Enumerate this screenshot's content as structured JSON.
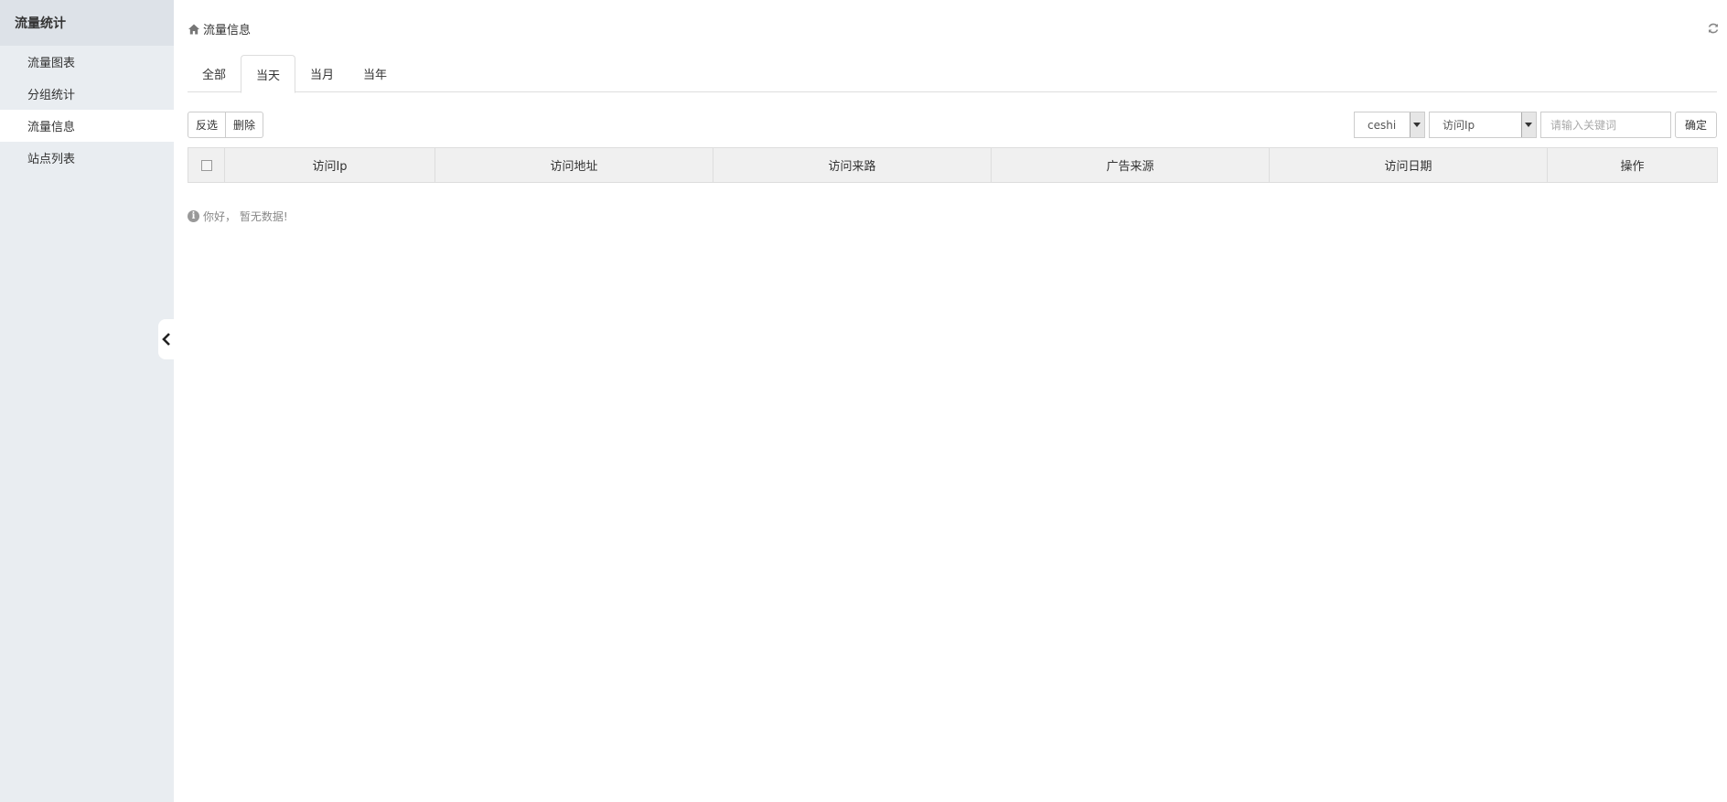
{
  "sidebar": {
    "title": "流量统计",
    "items": [
      {
        "label": "流量图表"
      },
      {
        "label": "分组统计"
      },
      {
        "label": "流量信息"
      },
      {
        "label": "站点列表"
      }
    ],
    "active_index": 2
  },
  "header": {
    "title": "流量信息"
  },
  "tabs": [
    {
      "label": "全部"
    },
    {
      "label": "当天"
    },
    {
      "label": "当月"
    },
    {
      "label": "当年"
    }
  ],
  "active_tab": 1,
  "toolbar": {
    "invert_label": "反选",
    "delete_label": "删除"
  },
  "filters": {
    "site_select": "ceshi",
    "field_select": "访问Ip",
    "keyword_placeholder": "请输入关键词",
    "confirm_label": "确定"
  },
  "table": {
    "columns": [
      "访问Ip",
      "访问地址",
      "访问来路",
      "广告来源",
      "访问日期",
      "操作"
    ]
  },
  "empty_message": "你好， 暂无数据!",
  "icons": {
    "home": "home-icon",
    "refresh": "refresh-icon",
    "collapse": "chevron-left-icon",
    "info": "info-icon"
  }
}
